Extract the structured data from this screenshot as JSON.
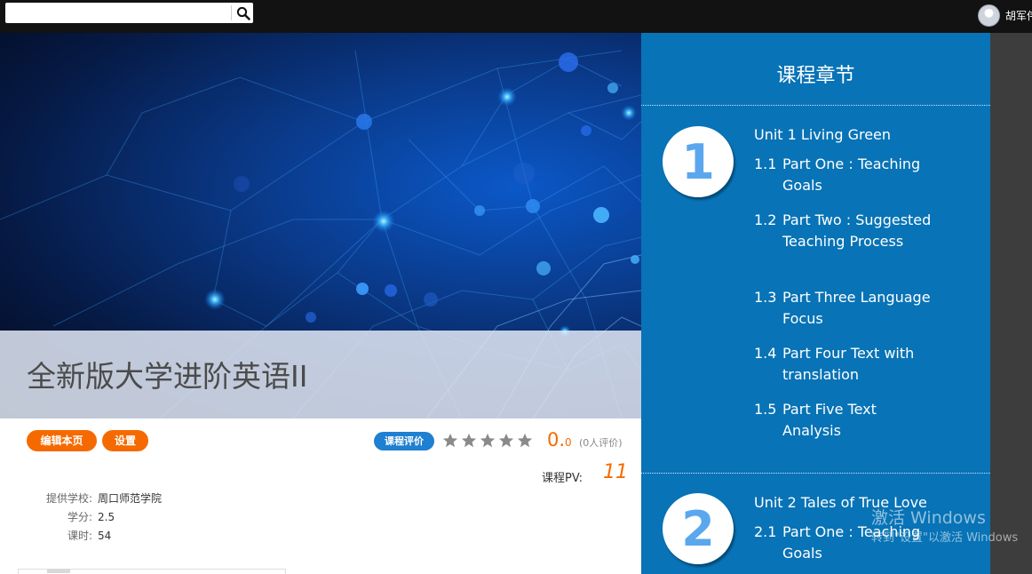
{
  "topbar": {
    "search_placeholder": "",
    "user_name": "胡军伟"
  },
  "course": {
    "title": "全新版大学进阶英语II",
    "edit_label": "编辑本页",
    "settings_label": "设置",
    "rate_label": "课程评价",
    "score_main": "0.",
    "score_small": "0",
    "rating_count": "(0人评价)",
    "stars_filled": 0,
    "stars_total": 5,
    "pv_label": "课程PV:",
    "pv_value": "11",
    "school_label": "提供学校:",
    "school_value": "周口师范学院",
    "credit_label": "学分:",
    "credit_value": "2.5",
    "hours_label": "课时:",
    "hours_value": "54"
  },
  "chapters": {
    "title": "课程章节",
    "units": [
      {
        "number": "1",
        "title": "Unit 1 Living Green",
        "sections": [
          {
            "n": "1.1",
            "t": "Part One : Teaching Goals"
          },
          {
            "n": "1.2",
            "t": "Part Two : Suggested Teaching Process"
          },
          {
            "n": "1.3",
            "t": "Part Three Language Focus"
          },
          {
            "n": "1.4",
            "t": "Part Four Text with translation"
          },
          {
            "n": "1.5",
            "t": "Part Five Text Analysis"
          }
        ]
      },
      {
        "number": "2",
        "title": "Unit 2 Tales of True Love",
        "sections": [
          {
            "n": "2.1",
            "t": "Part One : Teaching Goals"
          }
        ]
      }
    ]
  },
  "watermark": {
    "line1": "激活 Windows",
    "line2": "转到\"设置\"以激活 Windows"
  },
  "colors": {
    "accent_orange": "#f56a00",
    "accent_blue": "#1f7fd0",
    "chapter_bg": "#0873b6"
  }
}
